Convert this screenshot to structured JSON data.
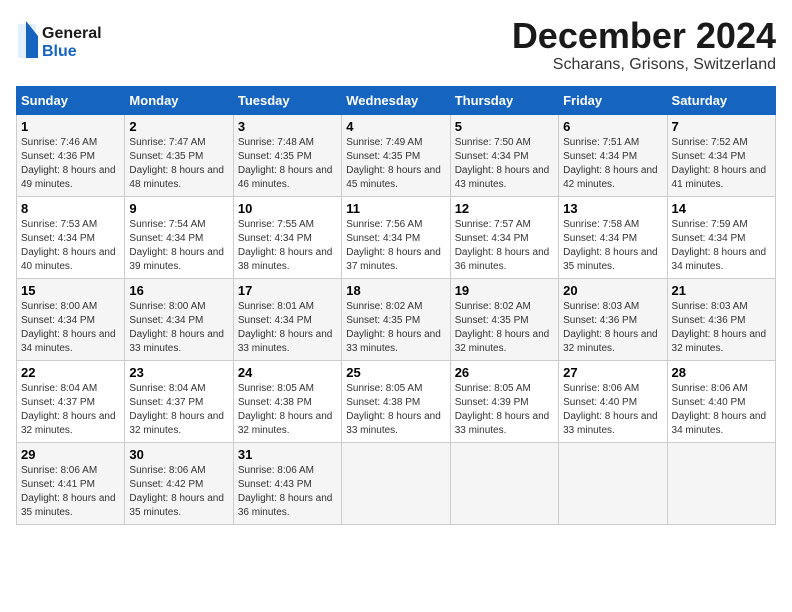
{
  "header": {
    "logo_general": "General",
    "logo_blue": "Blue",
    "month_title": "December 2024",
    "location": "Scharans, Grisons, Switzerland"
  },
  "days_of_week": [
    "Sunday",
    "Monday",
    "Tuesday",
    "Wednesday",
    "Thursday",
    "Friday",
    "Saturday"
  ],
  "weeks": [
    [
      {
        "day": "1",
        "sunrise": "Sunrise: 7:46 AM",
        "sunset": "Sunset: 4:36 PM",
        "daylight": "Daylight: 8 hours and 49 minutes."
      },
      {
        "day": "2",
        "sunrise": "Sunrise: 7:47 AM",
        "sunset": "Sunset: 4:35 PM",
        "daylight": "Daylight: 8 hours and 48 minutes."
      },
      {
        "day": "3",
        "sunrise": "Sunrise: 7:48 AM",
        "sunset": "Sunset: 4:35 PM",
        "daylight": "Daylight: 8 hours and 46 minutes."
      },
      {
        "day": "4",
        "sunrise": "Sunrise: 7:49 AM",
        "sunset": "Sunset: 4:35 PM",
        "daylight": "Daylight: 8 hours and 45 minutes."
      },
      {
        "day": "5",
        "sunrise": "Sunrise: 7:50 AM",
        "sunset": "Sunset: 4:34 PM",
        "daylight": "Daylight: 8 hours and 43 minutes."
      },
      {
        "day": "6",
        "sunrise": "Sunrise: 7:51 AM",
        "sunset": "Sunset: 4:34 PM",
        "daylight": "Daylight: 8 hours and 42 minutes."
      },
      {
        "day": "7",
        "sunrise": "Sunrise: 7:52 AM",
        "sunset": "Sunset: 4:34 PM",
        "daylight": "Daylight: 8 hours and 41 minutes."
      }
    ],
    [
      {
        "day": "8",
        "sunrise": "Sunrise: 7:53 AM",
        "sunset": "Sunset: 4:34 PM",
        "daylight": "Daylight: 8 hours and 40 minutes."
      },
      {
        "day": "9",
        "sunrise": "Sunrise: 7:54 AM",
        "sunset": "Sunset: 4:34 PM",
        "daylight": "Daylight: 8 hours and 39 minutes."
      },
      {
        "day": "10",
        "sunrise": "Sunrise: 7:55 AM",
        "sunset": "Sunset: 4:34 PM",
        "daylight": "Daylight: 8 hours and 38 minutes."
      },
      {
        "day": "11",
        "sunrise": "Sunrise: 7:56 AM",
        "sunset": "Sunset: 4:34 PM",
        "daylight": "Daylight: 8 hours and 37 minutes."
      },
      {
        "day": "12",
        "sunrise": "Sunrise: 7:57 AM",
        "sunset": "Sunset: 4:34 PM",
        "daylight": "Daylight: 8 hours and 36 minutes."
      },
      {
        "day": "13",
        "sunrise": "Sunrise: 7:58 AM",
        "sunset": "Sunset: 4:34 PM",
        "daylight": "Daylight: 8 hours and 35 minutes."
      },
      {
        "day": "14",
        "sunrise": "Sunrise: 7:59 AM",
        "sunset": "Sunset: 4:34 PM",
        "daylight": "Daylight: 8 hours and 34 minutes."
      }
    ],
    [
      {
        "day": "15",
        "sunrise": "Sunrise: 8:00 AM",
        "sunset": "Sunset: 4:34 PM",
        "daylight": "Daylight: 8 hours and 34 minutes."
      },
      {
        "day": "16",
        "sunrise": "Sunrise: 8:00 AM",
        "sunset": "Sunset: 4:34 PM",
        "daylight": "Daylight: 8 hours and 33 minutes."
      },
      {
        "day": "17",
        "sunrise": "Sunrise: 8:01 AM",
        "sunset": "Sunset: 4:34 PM",
        "daylight": "Daylight: 8 hours and 33 minutes."
      },
      {
        "day": "18",
        "sunrise": "Sunrise: 8:02 AM",
        "sunset": "Sunset: 4:35 PM",
        "daylight": "Daylight: 8 hours and 33 minutes."
      },
      {
        "day": "19",
        "sunrise": "Sunrise: 8:02 AM",
        "sunset": "Sunset: 4:35 PM",
        "daylight": "Daylight: 8 hours and 32 minutes."
      },
      {
        "day": "20",
        "sunrise": "Sunrise: 8:03 AM",
        "sunset": "Sunset: 4:36 PM",
        "daylight": "Daylight: 8 hours and 32 minutes."
      },
      {
        "day": "21",
        "sunrise": "Sunrise: 8:03 AM",
        "sunset": "Sunset: 4:36 PM",
        "daylight": "Daylight: 8 hours and 32 minutes."
      }
    ],
    [
      {
        "day": "22",
        "sunrise": "Sunrise: 8:04 AM",
        "sunset": "Sunset: 4:37 PM",
        "daylight": "Daylight: 8 hours and 32 minutes."
      },
      {
        "day": "23",
        "sunrise": "Sunrise: 8:04 AM",
        "sunset": "Sunset: 4:37 PM",
        "daylight": "Daylight: 8 hours and 32 minutes."
      },
      {
        "day": "24",
        "sunrise": "Sunrise: 8:05 AM",
        "sunset": "Sunset: 4:38 PM",
        "daylight": "Daylight: 8 hours and 32 minutes."
      },
      {
        "day": "25",
        "sunrise": "Sunrise: 8:05 AM",
        "sunset": "Sunset: 4:38 PM",
        "daylight": "Daylight: 8 hours and 33 minutes."
      },
      {
        "day": "26",
        "sunrise": "Sunrise: 8:05 AM",
        "sunset": "Sunset: 4:39 PM",
        "daylight": "Daylight: 8 hours and 33 minutes."
      },
      {
        "day": "27",
        "sunrise": "Sunrise: 8:06 AM",
        "sunset": "Sunset: 4:40 PM",
        "daylight": "Daylight: 8 hours and 33 minutes."
      },
      {
        "day": "28",
        "sunrise": "Sunrise: 8:06 AM",
        "sunset": "Sunset: 4:40 PM",
        "daylight": "Daylight: 8 hours and 34 minutes."
      }
    ],
    [
      {
        "day": "29",
        "sunrise": "Sunrise: 8:06 AM",
        "sunset": "Sunset: 4:41 PM",
        "daylight": "Daylight: 8 hours and 35 minutes."
      },
      {
        "day": "30",
        "sunrise": "Sunrise: 8:06 AM",
        "sunset": "Sunset: 4:42 PM",
        "daylight": "Daylight: 8 hours and 35 minutes."
      },
      {
        "day": "31",
        "sunrise": "Sunrise: 8:06 AM",
        "sunset": "Sunset: 4:43 PM",
        "daylight": "Daylight: 8 hours and 36 minutes."
      },
      null,
      null,
      null,
      null
    ]
  ]
}
